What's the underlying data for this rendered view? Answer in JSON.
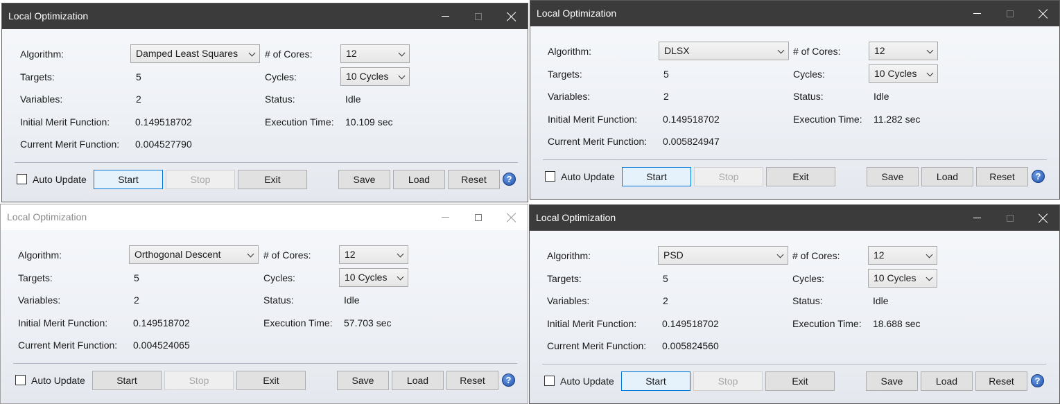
{
  "windows": [
    {
      "title": "Local Optimization",
      "active": true,
      "algorithm_label": "Algorithm:",
      "algorithm": "Damped Least Squares",
      "cores_label": "# of Cores:",
      "cores": "12",
      "targets_label": "Targets:",
      "targets": "5",
      "cycles_label": "Cycles:",
      "cycles": "10 Cycles",
      "variables_label": "Variables:",
      "variables": "2",
      "status_label": "Status:",
      "status": "Idle",
      "initial_mf_label": "Initial Merit Function:",
      "initial_mf": "0.149518702",
      "exec_time_label": "Execution Time:",
      "exec_time": "10.109 sec",
      "current_mf_label": "Current Merit Function:",
      "current_mf": "0.004527790",
      "auto_update_label": "Auto Update",
      "start_label": "Start",
      "stop_label": "Stop",
      "exit_label": "Exit",
      "save_label": "Save",
      "load_label": "Load",
      "reset_label": "Reset",
      "help_glyph": "?"
    },
    {
      "title": "Local Optimization",
      "active": true,
      "algorithm_label": "Algorithm:",
      "algorithm": "DLSX",
      "cores_label": "# of Cores:",
      "cores": "12",
      "targets_label": "Targets:",
      "targets": "5",
      "cycles_label": "Cycles:",
      "cycles": "10 Cycles",
      "variables_label": "Variables:",
      "variables": "2",
      "status_label": "Status:",
      "status": "Idle",
      "initial_mf_label": "Initial Merit Function:",
      "initial_mf": "0.149518702",
      "exec_time_label": "Execution Time:",
      "exec_time": "11.282 sec",
      "current_mf_label": "Current Merit Function:",
      "current_mf": "0.005824947",
      "auto_update_label": "Auto Update",
      "start_label": "Start",
      "stop_label": "Stop",
      "exit_label": "Exit",
      "save_label": "Save",
      "load_label": "Load",
      "reset_label": "Reset",
      "help_glyph": "?"
    },
    {
      "title": "Local Optimization",
      "active": false,
      "algorithm_label": "Algorithm:",
      "algorithm": "Orthogonal Descent",
      "cores_label": "# of Cores:",
      "cores": "12",
      "targets_label": "Targets:",
      "targets": "5",
      "cycles_label": "Cycles:",
      "cycles": "10 Cycles",
      "variables_label": "Variables:",
      "variables": "2",
      "status_label": "Status:",
      "status": "Idle",
      "initial_mf_label": "Initial Merit Function:",
      "initial_mf": "0.149518702",
      "exec_time_label": "Execution Time:",
      "exec_time": "57.703 sec",
      "current_mf_label": "Current Merit Function:",
      "current_mf": "0.004524065",
      "auto_update_label": "Auto Update",
      "start_label": "Start",
      "stop_label": "Stop",
      "exit_label": "Exit",
      "save_label": "Save",
      "load_label": "Load",
      "reset_label": "Reset",
      "help_glyph": "?"
    },
    {
      "title": "Local Optimization",
      "active": true,
      "algorithm_label": "Algorithm:",
      "algorithm": "PSD",
      "cores_label": "# of Cores:",
      "cores": "12",
      "targets_label": "Targets:",
      "targets": "5",
      "cycles_label": "Cycles:",
      "cycles": "10 Cycles",
      "variables_label": "Variables:",
      "variables": "2",
      "status_label": "Status:",
      "status": "Idle",
      "initial_mf_label": "Initial Merit Function:",
      "initial_mf": "0.149518702",
      "exec_time_label": "Execution Time:",
      "exec_time": "18.688 sec",
      "current_mf_label": "Current Merit Function:",
      "current_mf": "0.005824560",
      "auto_update_label": "Auto Update",
      "start_label": "Start",
      "stop_label": "Stop",
      "exit_label": "Exit",
      "save_label": "Save",
      "load_label": "Load",
      "reset_label": "Reset",
      "help_glyph": "?"
    }
  ]
}
